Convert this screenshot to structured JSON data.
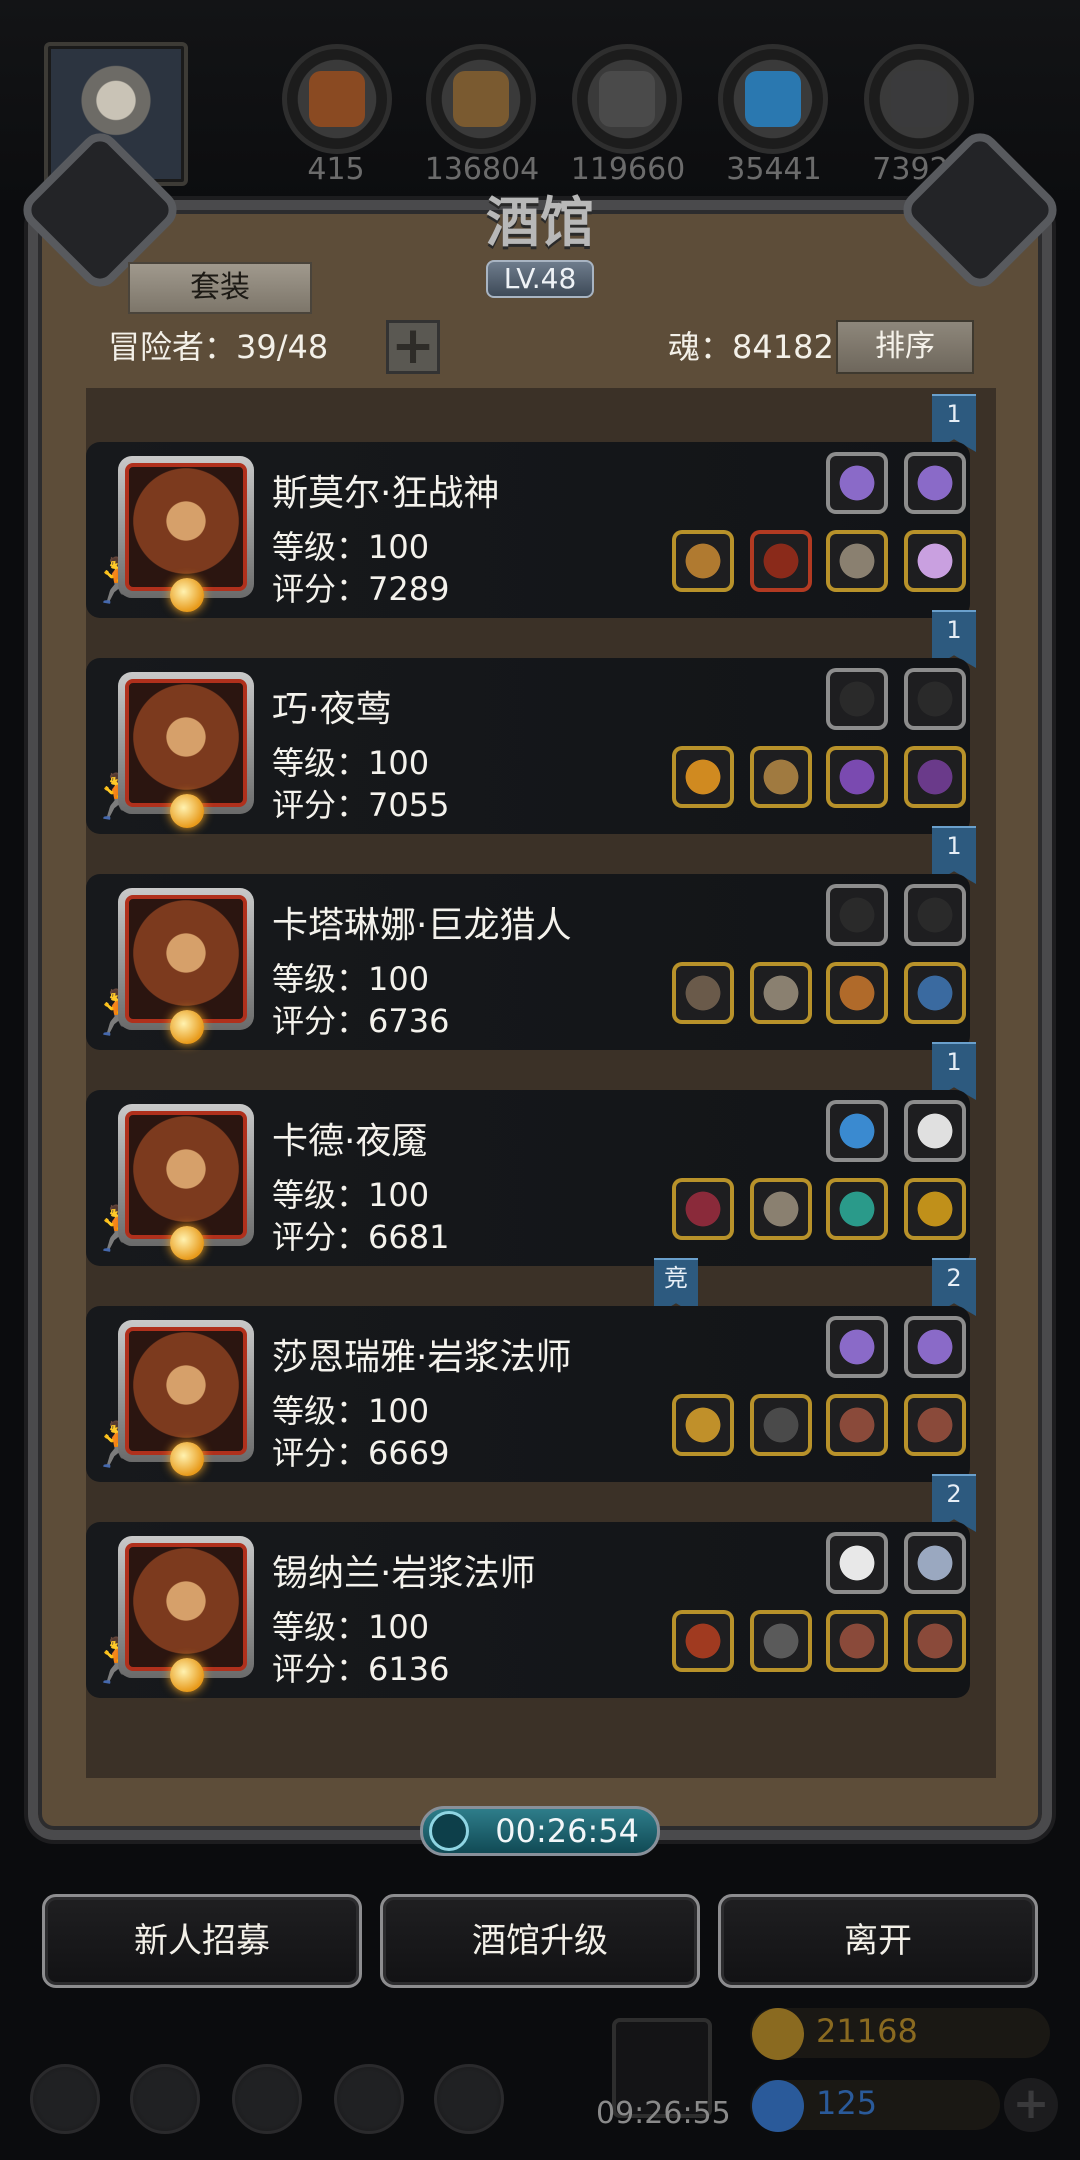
{
  "header": {
    "resources": [
      {
        "name": "ore",
        "value": "415",
        "color": "#8a4a22"
      },
      {
        "name": "wood",
        "value": "136804",
        "color": "#7a5a30"
      },
      {
        "name": "iron",
        "value": "119660",
        "color": "#4a4a4a"
      },
      {
        "name": "crystal",
        "value": "35441",
        "color": "#2a78b0"
      },
      {
        "name": "steel",
        "value": "73925",
        "color": "#3a3a3c"
      }
    ]
  },
  "tavern": {
    "title": "酒馆",
    "level": "LV.48",
    "set_button": "套装",
    "adventurers": "冒险者：39/48",
    "add_symbol": "+",
    "soul": "魂：84182",
    "sort_button": "排序"
  },
  "heroes": [
    {
      "name": "斯莫尔·狂战神",
      "level": "等级：100",
      "score": "评分：7289",
      "ribbon": "1",
      "top_slots": [
        "#8a6ac8",
        "#8a6ac8"
      ],
      "bottom_slots": [
        "#b07a30",
        "#8a2a1a",
        "#8a8070",
        "#c9a0e0"
      ]
    },
    {
      "name": "巧·夜莺",
      "level": "等级：100",
      "score": "评分：7055",
      "ribbon": "1",
      "top_slots": [
        "#2a2a2a",
        "#2a2a2a"
      ],
      "bottom_slots": [
        "#d08a20",
        "#a07a40",
        "#7a4ab0",
        "#6a3a8a"
      ]
    },
    {
      "name": "卡塔琳娜·巨龙猎人",
      "level": "等级：100",
      "score": "评分：6736",
      "ribbon": "1",
      "top_slots": [
        "#2a2a2a",
        "#2a2a2a"
      ],
      "bottom_slots": [
        "#6a5a4a",
        "#8a8070",
        "#b06a2a",
        "#3a6aa0"
      ]
    },
    {
      "name": "卡德·夜魇",
      "level": "等级：100",
      "score": "评分：6681",
      "ribbon": "1",
      "top_slots": [
        "#3a8ad0",
        "#e0e0e0"
      ],
      "bottom_slots": [
        "#8a2a3a",
        "#8a8070",
        "#2a9a8a",
        "#c0901a"
      ]
    },
    {
      "name": "莎恩瑞雅·岩浆法师",
      "level": "等级：100",
      "score": "评分：6669",
      "ribbon": "2",
      "extra_ribbon": "竞",
      "top_slots": [
        "#8a6ac8",
        "#8a6ac8"
      ],
      "bottom_slots": [
        "#c0902a",
        "#4a4a4a",
        "#8a4a3a",
        "#8a4a3a"
      ]
    },
    {
      "name": "锡纳兰·岩浆法师",
      "level": "等级：100",
      "score": "评分：6136",
      "ribbon": "2",
      "top_slots": [
        "#e8e8e8",
        "#9aa8c0"
      ],
      "bottom_slots": [
        "#a03a20",
        "#5a5a5a",
        "#8a4a3a",
        "#8a4a3a"
      ]
    }
  ],
  "timer": "00:26:54",
  "buttons": {
    "recruit": "新人招募",
    "upgrade": "酒馆升级",
    "leave": "离开"
  },
  "hud": {
    "gift_timer": "09:26:55",
    "gold": "21168",
    "gems": "125",
    "gold_color": "#8a6a20",
    "gem_color": "#2a5a9a"
  }
}
